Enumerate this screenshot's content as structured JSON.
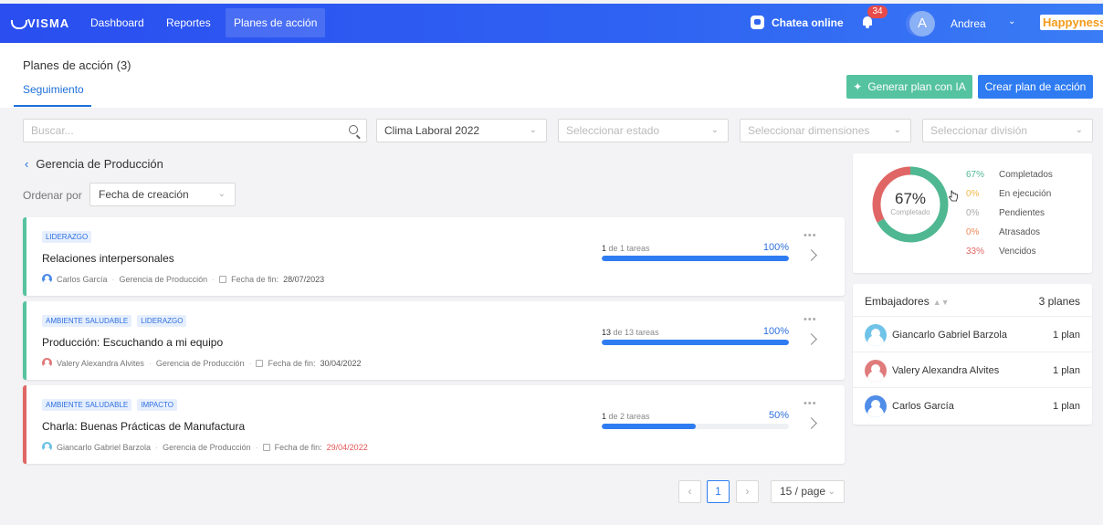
{
  "nav": {
    "logo": "VISMA",
    "links": [
      "Dashboard",
      "Reportes",
      "Planes de acción"
    ],
    "chat": "Chatea online",
    "notifications": "34",
    "avatar_initial": "A",
    "user": "Andrea",
    "brand": "Happyness"
  },
  "header": {
    "title": "Planes de acción (3)",
    "tab": "Seguimiento",
    "btn_ia": "Generar plan con IA",
    "btn_crear": "Crear plan de acción"
  },
  "filters": {
    "search_placeholder": "Buscar...",
    "survey": "Clima Laboral 2022",
    "estado": "Seleccionar estado",
    "dimensiones": "Seleccionar dimensiones",
    "division": "Seleccionar división"
  },
  "group": "Gerencia de Producción",
  "order": {
    "label": "Ordenar por",
    "value": "Fecha de creación"
  },
  "plans": [
    {
      "tags": [
        "LIDERAZGO"
      ],
      "title": "Relaciones interpersonales",
      "owner": "Carlos García",
      "area": "Gerencia de Producción",
      "date_label": "Fecha de fin:",
      "date": "28/07/2023",
      "done": "1",
      "tasks_text": "de 1 tareas",
      "progress": 100,
      "pct": "100%",
      "stripe": "#56c3a0",
      "avatar_color": "#4f8de8",
      "date_late": false
    },
    {
      "tags": [
        "AMBIENTE SALUDABLE",
        "LIDERAZGO"
      ],
      "title": "Producción: Escuchando a mi equipo",
      "owner": "Valery Alexandra Alvites",
      "area": "Gerencia de Producción",
      "date_label": "Fecha de fin:",
      "date": "30/04/2022",
      "done": "13",
      "tasks_text": "de 13 tareas",
      "progress": 100,
      "pct": "100%",
      "stripe": "#56c3a0",
      "avatar_color": "#e07b7b",
      "date_late": false
    },
    {
      "tags": [
        "AMBIENTE SALUDABLE",
        "IMPACTO"
      ],
      "title": "Charla: Buenas Prácticas de Manufactura",
      "owner": "Giancarlo Gabriel Barzola",
      "area": "Gerencia de Producción",
      "date_label": "Fecha de fin:",
      "date": "29/04/2022",
      "done": "1",
      "tasks_text": "de 2 tareas",
      "progress": 50,
      "pct": "50%",
      "stripe": "#e06666",
      "avatar_color": "#6fc3e8",
      "date_late": true
    }
  ],
  "summary": {
    "center_value": "67%",
    "center_label": "Completado",
    "legend": [
      {
        "pct": "67%",
        "label": "Completados",
        "color": "#4fb892",
        "fraction": 0.67
      },
      {
        "pct": "0%",
        "label": "En ejecución",
        "color": "#f0b94a",
        "fraction": 0
      },
      {
        "pct": "0%",
        "label": "Pendientes",
        "color": "#aaaaaa",
        "fraction": 0
      },
      {
        "pct": "0%",
        "label": "Atrasados",
        "color": "#ee8a5a",
        "fraction": 0
      },
      {
        "pct": "33%",
        "label": "Vencidos",
        "color": "#e06666",
        "fraction": 0.33
      }
    ]
  },
  "ambassadors": {
    "title": "Embajadores",
    "total": "3 planes",
    "rows": [
      {
        "name": "Giancarlo Gabriel Barzola",
        "plans": "1 plan",
        "color": "#6fc3e8"
      },
      {
        "name": "Valery Alexandra Alvites",
        "plans": "1 plan",
        "color": "#e07b7b"
      },
      {
        "name": "Carlos García",
        "plans": "1 plan",
        "color": "#4f8de8"
      }
    ]
  },
  "pagination": {
    "current": "1",
    "page_size": "15 / page"
  },
  "colors": {
    "primary": "#2f7cf2",
    "accent_green": "#56c3a0",
    "danger": "#e06666"
  }
}
